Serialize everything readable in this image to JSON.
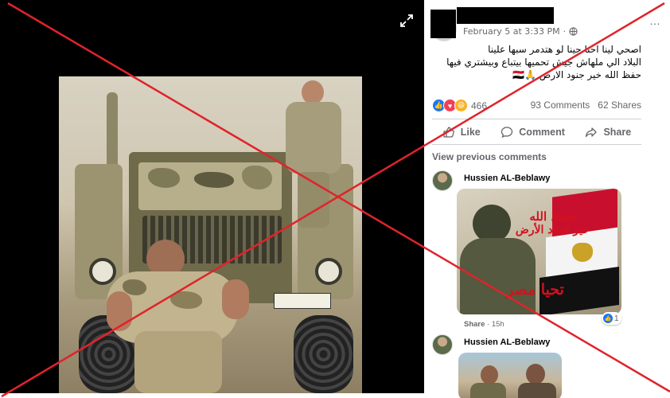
{
  "post": {
    "timestamp": "February 5 at 3:33 PM",
    "privacy_icon": "globe-icon",
    "text_lines": [
      "اصحي لينا احنا جينا لو هتدمر سبها علينا",
      "البلاد الي ملهاش جيش تحميها بيتباع وبيشتري فيها",
      "حفظ الله خير جنود الارض 🙏🇪🇬"
    ]
  },
  "reactions": {
    "icons": [
      "like-icon",
      "love-icon",
      "haha-icon"
    ],
    "count": "466"
  },
  "counts": {
    "comments": "93 Comments",
    "shares": "62 Shares"
  },
  "actions": {
    "like": "Like",
    "comment": "Comment",
    "share": "Share"
  },
  "comments_section": {
    "view_previous": "View previous comments",
    "items": [
      {
        "author": "Hussien AL-Beblawy",
        "image_text_line1": "حفظ الله",
        "image_text_line2": "خير أجناد الأرض",
        "image_text_line3": "تحيا مصر",
        "share_label": "Share",
        "time": "15h",
        "like_count": "1"
      },
      {
        "author": "Hussien AL-Beblawy"
      }
    ]
  },
  "colors": {
    "accent": "#1877f2",
    "cross": "#e0232b",
    "muted_text": "#65676b",
    "photo_bg": "#000000"
  }
}
